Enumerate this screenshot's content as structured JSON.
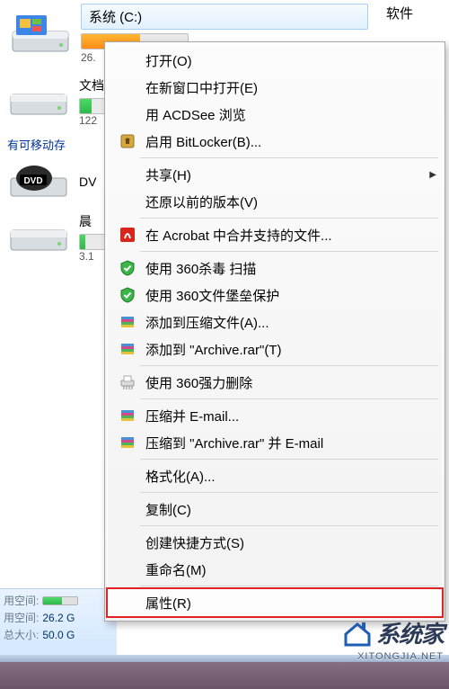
{
  "header": {
    "main_drive_label": "系统 (C:)",
    "main_drive_used": "26.",
    "second_col_label": "软件"
  },
  "section": {
    "removable": "有可移动存"
  },
  "drives": [
    {
      "name": "文档",
      "sub": "122"
    },
    {
      "name": "DV"
    },
    {
      "name": "晨",
      "sub": "3.1"
    }
  ],
  "statusbar": {
    "used_label": "用空间:",
    "used_value_row": "用空间:",
    "used_value": "26.2 G",
    "total_label": "总大小:",
    "total_value": "50.0 G"
  },
  "watermark": {
    "text": "系统家",
    "sub": "XITONGJIA.NET"
  },
  "menu": [
    {
      "label": "打开(O)"
    },
    {
      "label": "在新窗口中打开(E)"
    },
    {
      "label": "用 ACDSee 浏览"
    },
    {
      "label": "启用 BitLocker(B)...",
      "icon": "bitlocker"
    },
    {
      "sep": true
    },
    {
      "label": "共享(H)",
      "sub": true
    },
    {
      "label": "还原以前的版本(V)"
    },
    {
      "sep": true
    },
    {
      "label": "在 Acrobat 中合并支持的文件...",
      "icon": "acrobat"
    },
    {
      "sep": true
    },
    {
      "label": "使用 360杀毒 扫描",
      "icon": "shield-green"
    },
    {
      "label": "使用 360文件堡垒保护",
      "icon": "shield-green"
    },
    {
      "label": "添加到压缩文件(A)...",
      "icon": "winrar"
    },
    {
      "label": "添加到 \"Archive.rar\"(T)",
      "icon": "winrar"
    },
    {
      "sep": true
    },
    {
      "label": "使用 360强力删除",
      "icon": "shredder"
    },
    {
      "sep": true
    },
    {
      "label": "压缩并 E-mail...",
      "icon": "winrar"
    },
    {
      "label": "压缩到 \"Archive.rar\" 并 E-mail",
      "icon": "winrar"
    },
    {
      "sep": true
    },
    {
      "label": "格式化(A)..."
    },
    {
      "sep": true
    },
    {
      "label": "复制(C)"
    },
    {
      "sep": true
    },
    {
      "label": "创建快捷方式(S)"
    },
    {
      "label": "重命名(M)"
    },
    {
      "sep": true
    },
    {
      "label": "属性(R)",
      "highlight": true
    }
  ]
}
